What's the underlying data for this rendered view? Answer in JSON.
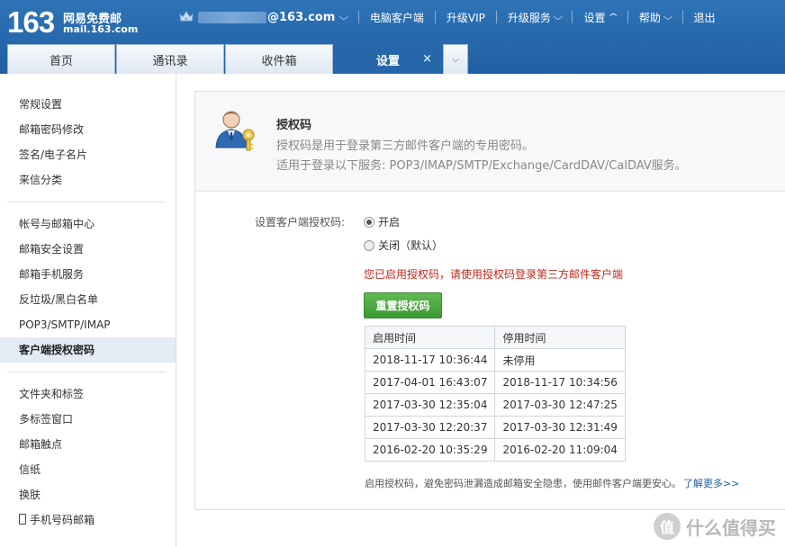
{
  "header": {
    "logo_number": "163",
    "logo_text": "网易免费邮",
    "logo_domain": "mail.163.com",
    "account_suffix": "@163.com",
    "nav": [
      {
        "label": "电脑客户端"
      },
      {
        "label": "升级VIP"
      },
      {
        "label": "升级服务"
      },
      {
        "label": "设置"
      },
      {
        "label": "帮助"
      },
      {
        "label": "退出"
      }
    ],
    "tabs": [
      {
        "label": "首页"
      },
      {
        "label": "通讯录"
      },
      {
        "label": "收件箱"
      },
      {
        "label": "设置"
      }
    ],
    "tab_close": "×"
  },
  "sidebar": {
    "group1": [
      "常规设置",
      "邮箱密码修改",
      "签名/电子名片",
      "来信分类"
    ],
    "group2": [
      "帐号与邮箱中心",
      "邮箱安全设置",
      "邮箱手机服务",
      "反垃圾/黑白名单",
      "POP3/SMTP/IMAP",
      "客户端授权密码"
    ],
    "group3": [
      "文件夹和标签",
      "多标签窗口",
      "邮箱触点",
      "信纸",
      "换肤",
      "手机号码邮箱"
    ]
  },
  "main": {
    "title": "授权码",
    "desc1": "授权码是用于登录第三方邮件客户端的专用密码。",
    "desc2": "适用于登录以下服务: POP3/IMAP/SMTP/Exchange/CardDAV/CalDAV服务。",
    "setting_label": "设置客户端授权码:",
    "option_on": "开启",
    "option_off": "关闭（默认）",
    "selected_option": "开启",
    "notice": "您已启用授权码，请使用授权码登录第三方邮件客户端",
    "reset_button": "重置授权码",
    "table": {
      "headers": [
        "启用时间",
        "停用时间"
      ],
      "rows": [
        [
          "2018-11-17 10:36:44",
          "未停用"
        ],
        [
          "2017-04-01 16:43:07",
          "2018-11-17 10:34:56"
        ],
        [
          "2017-03-30 12:35:04",
          "2017-03-30 12:47:25"
        ],
        [
          "2017-03-30 12:20:37",
          "2017-03-30 12:31:49"
        ],
        [
          "2016-02-20 10:35:29",
          "2016-02-20 11:09:04"
        ]
      ]
    },
    "footnote": "启用授权码，避免密码泄漏造成邮箱安全隐患，使用邮件客户端更安心。",
    "learn_more": "了解更多>>"
  },
  "watermark": {
    "logo_char": "值",
    "text": "什么值得买"
  },
  "colors": {
    "header_blue": "#2f74b8",
    "active_tab": "#2667a9",
    "button_green": "#4aa83e",
    "notice_red": "#c0281c"
  }
}
